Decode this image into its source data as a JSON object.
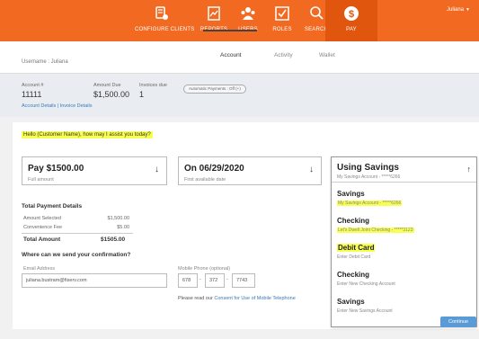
{
  "nav": {
    "items": [
      {
        "label": "CONFIGURE CLIENTS",
        "icon": "clients-icon"
      },
      {
        "label": "REPORTS",
        "icon": "reports-icon"
      },
      {
        "label": "USERS",
        "icon": "users-icon"
      },
      {
        "label": "ROLES",
        "icon": "roles-icon"
      },
      {
        "label": "SEARCH",
        "icon": "search-icon"
      },
      {
        "label": "PAY",
        "icon": "pay-icon"
      }
    ],
    "user": "Juliana",
    "accent": "#f26a21"
  },
  "sub": {
    "username": "Username : Juliana",
    "tabs": [
      "Account",
      "Activity",
      "Wallet"
    ]
  },
  "account": {
    "number_label": "Account #",
    "number": "11111",
    "due_label": "Amount Due",
    "due": "$1,500.00",
    "invoices_label": "Invoices due",
    "invoices": "1",
    "autopay": "Automatic Payments : Off (+)",
    "links": "Account Details  |  Invoice Details"
  },
  "greeting": "Hello (Customer Name), how may I assist you today?",
  "pay_amount": {
    "main": "Pay $1500.00",
    "sub": "Full amount"
  },
  "pay_date": {
    "main": "On 06/29/2020",
    "sub": "First available date"
  },
  "details": {
    "title": "Total Payment Details",
    "rows": [
      {
        "label": "Amount Selected",
        "value": "$1,500.00"
      },
      {
        "label": "Convenience Fee",
        "value": "$5.00"
      }
    ],
    "total_label": "Total Amount",
    "total_value": "$1505.00"
  },
  "confirm": {
    "title": "Where can we send your confirmation?",
    "email_label": "Email Address",
    "email_value": "juliana.bustram@fiserv.com",
    "phone_label": "Mobile Phone (optional)",
    "phone": [
      "678",
      "372",
      "7743"
    ],
    "terms_text": "Please read our",
    "terms_link": "Consent for Use of Mobile Telephone"
  },
  "method": {
    "selected": {
      "title": "Using Savings",
      "sub": "My Savings Account - *****6266"
    },
    "options": [
      {
        "title": "Savings",
        "sub": "My Savings Account - *****6266",
        "highlight": true
      },
      {
        "title": "Checking",
        "sub": "Let's Dwell Joint Checking - *****3123",
        "highlight": true
      },
      {
        "title": "Debit Card",
        "sub": "Enter Debit Card",
        "highlight": true
      },
      {
        "title": "Checking",
        "sub": "Enter New Checking Account",
        "highlight": false
      },
      {
        "title": "Savings",
        "sub": "Enter New Savings Account",
        "highlight": false
      }
    ]
  },
  "continue_label": "Continue"
}
